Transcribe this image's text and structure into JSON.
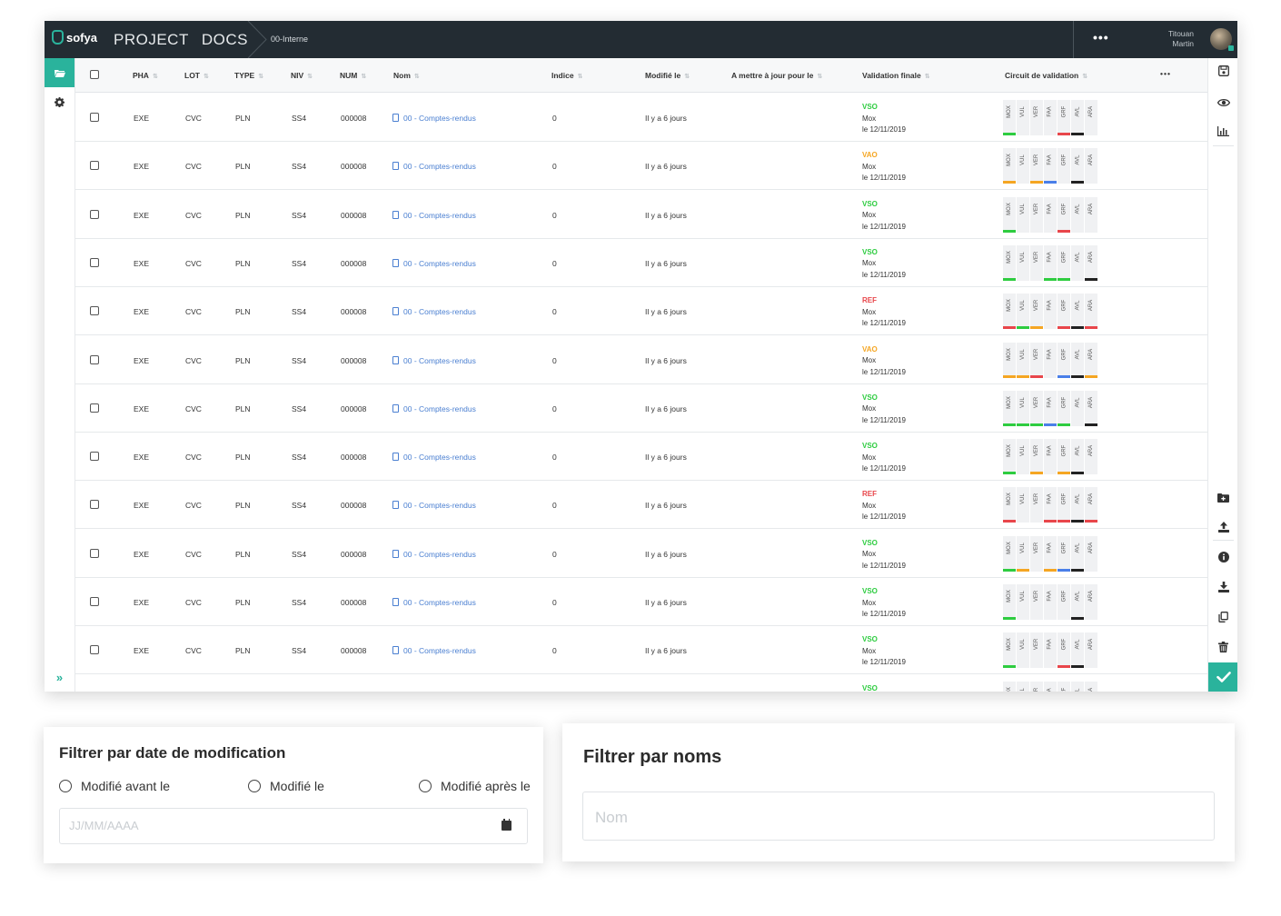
{
  "app": {
    "logo_text": "sofya",
    "title_word1": "PROJECT",
    "title_word2": "DOCS",
    "breadcrumb": "00-Interne",
    "more_label": "•••",
    "user_first": "Titouan",
    "user_last": "Martin"
  },
  "colors": {
    "accent": "#2ab39c",
    "topbar": "#232c33",
    "green": "#2ecc40",
    "orange": "#f5a623",
    "red": "#e8464b",
    "blue": "#4a7fe8",
    "black": "#222222",
    "link": "#4a7fd1"
  },
  "table": {
    "columns": [
      "PHA",
      "LOT",
      "TYPE",
      "NIV",
      "NUM",
      "Nom",
      "Indice",
      "Modifié le",
      "A mettre à jour pour le",
      "Validation finale",
      "Circuit de validation"
    ],
    "more_label": "•••",
    "circuit_labels": [
      "MOX",
      "VUL",
      "VER",
      "FAA",
      "GRF",
      "AVL",
      "ARA"
    ],
    "rows": [
      {
        "pha": "EXE",
        "lot": "CVC",
        "type": "PLN",
        "niv": "SS4",
        "num": "000008",
        "nom": "00 - Comptes-rendus",
        "indice": "0",
        "modifie": "Il y a 6 jours",
        "status": "VSO",
        "status_color": "#2ecc40",
        "by": "Mox",
        "date": "le 12/11/2019",
        "bars": [
          "#2ecc40",
          null,
          null,
          null,
          "#e8464b",
          "#222222",
          null
        ]
      },
      {
        "pha": "EXE",
        "lot": "CVC",
        "type": "PLN",
        "niv": "SS4",
        "num": "000008",
        "nom": "00 - Comptes-rendus",
        "indice": "0",
        "modifie": "Il y a 6 jours",
        "status": "VAO",
        "status_color": "#f5a623",
        "by": "Mox",
        "date": "le 12/11/2019",
        "bars": [
          "#f5a623",
          null,
          "#f5a623",
          "#4a7fe8",
          null,
          "#222222",
          null
        ]
      },
      {
        "pha": "EXE",
        "lot": "CVC",
        "type": "PLN",
        "niv": "SS4",
        "num": "000008",
        "nom": "00 - Comptes-rendus",
        "indice": "0",
        "modifie": "Il y a 6 jours",
        "status": "VSO",
        "status_color": "#2ecc40",
        "by": "Mox",
        "date": "le 12/11/2019",
        "bars": [
          "#2ecc40",
          null,
          null,
          null,
          "#e8464b",
          null,
          null
        ]
      },
      {
        "pha": "EXE",
        "lot": "CVC",
        "type": "PLN",
        "niv": "SS4",
        "num": "000008",
        "nom": "00 - Comptes-rendus",
        "indice": "0",
        "modifie": "Il y a 6 jours",
        "status": "VSO",
        "status_color": "#2ecc40",
        "by": "Mox",
        "date": "le 12/11/2019",
        "bars": [
          "#2ecc40",
          null,
          null,
          "#2ecc40",
          "#2ecc40",
          null,
          "#222222"
        ]
      },
      {
        "pha": "EXE",
        "lot": "CVC",
        "type": "PLN",
        "niv": "SS4",
        "num": "000008",
        "nom": "00 - Comptes-rendus",
        "indice": "0",
        "modifie": "Il y a 6 jours",
        "status": "REF",
        "status_color": "#e8464b",
        "by": "Mox",
        "date": "le 12/11/2019",
        "bars": [
          "#e8464b",
          "#2ecc40",
          "#f5a623",
          null,
          "#e8464b",
          "#222222",
          "#e8464b"
        ]
      },
      {
        "pha": "EXE",
        "lot": "CVC",
        "type": "PLN",
        "niv": "SS4",
        "num": "000008",
        "nom": "00 - Comptes-rendus",
        "indice": "0",
        "modifie": "Il y a 6 jours",
        "status": "VAO",
        "status_color": "#f5a623",
        "by": "Mox",
        "date": "le 12/11/2019",
        "bars": [
          "#f5a623",
          "#f5a623",
          "#e8464b",
          null,
          "#4a7fe8",
          "#222222",
          "#f5a623"
        ]
      },
      {
        "pha": "EXE",
        "lot": "CVC",
        "type": "PLN",
        "niv": "SS4",
        "num": "000008",
        "nom": "00 - Comptes-rendus",
        "indice": "0",
        "modifie": "Il y a 6 jours",
        "status": "VSO",
        "status_color": "#2ecc40",
        "by": "Mox",
        "date": "le 12/11/2019",
        "bars": [
          "#2ecc40",
          "#2ecc40",
          "#2ecc40",
          "#4a7fe8",
          "#2ecc40",
          null,
          "#222222"
        ]
      },
      {
        "pha": "EXE",
        "lot": "CVC",
        "type": "PLN",
        "niv": "SS4",
        "num": "000008",
        "nom": "00 - Comptes-rendus",
        "indice": "0",
        "modifie": "Il y a 6 jours",
        "status": "VSO",
        "status_color": "#2ecc40",
        "by": "Mox",
        "date": "le 12/11/2019",
        "bars": [
          "#2ecc40",
          null,
          "#f5a623",
          null,
          "#f5a623",
          "#222222",
          null
        ]
      },
      {
        "pha": "EXE",
        "lot": "CVC",
        "type": "PLN",
        "niv": "SS4",
        "num": "000008",
        "nom": "00 - Comptes-rendus",
        "indice": "0",
        "modifie": "Il y a 6 jours",
        "status": "REF",
        "status_color": "#e8464b",
        "by": "Mox",
        "date": "le 12/11/2019",
        "bars": [
          "#e8464b",
          null,
          null,
          "#e8464b",
          "#e8464b",
          "#222222",
          "#e8464b"
        ]
      },
      {
        "pha": "EXE",
        "lot": "CVC",
        "type": "PLN",
        "niv": "SS4",
        "num": "000008",
        "nom": "00 - Comptes-rendus",
        "indice": "0",
        "modifie": "Il y a 6 jours",
        "status": "VSO",
        "status_color": "#2ecc40",
        "by": "Mox",
        "date": "le 12/11/2019",
        "bars": [
          "#2ecc40",
          "#f5a623",
          null,
          "#f5a623",
          "#4a7fe8",
          "#222222",
          null
        ]
      },
      {
        "pha": "EXE",
        "lot": "CVC",
        "type": "PLN",
        "niv": "SS4",
        "num": "000008",
        "nom": "00 - Comptes-rendus",
        "indice": "0",
        "modifie": "Il y a 6 jours",
        "status": "VSO",
        "status_color": "#2ecc40",
        "by": "Mox",
        "date": "le 12/11/2019",
        "bars": [
          "#2ecc40",
          null,
          null,
          null,
          null,
          "#222222",
          null
        ]
      },
      {
        "pha": "EXE",
        "lot": "CVC",
        "type": "PLN",
        "niv": "SS4",
        "num": "000008",
        "nom": "00 - Comptes-rendus",
        "indice": "0",
        "modifie": "Il y a 6 jours",
        "status": "VSO",
        "status_color": "#2ecc40",
        "by": "Mox",
        "date": "le 12/11/2019",
        "bars": [
          "#2ecc40",
          null,
          null,
          null,
          "#e8464b",
          "#222222",
          null
        ]
      },
      {
        "pha": "",
        "lot": "",
        "type": "",
        "niv": "",
        "num": "",
        "nom": "",
        "indice": "",
        "modifie": "",
        "status": "VSO",
        "status_color": "#2ecc40",
        "by": "",
        "date": "",
        "bars": [
          null,
          null,
          null,
          null,
          null,
          null,
          null
        ]
      }
    ]
  },
  "icons": {
    "left": [
      "folder-icon",
      "gear-icon",
      "double-chevron-right-icon"
    ],
    "right_top": [
      "save-icon",
      "eye-icon",
      "chart-icon"
    ],
    "right_bottom": [
      "add-folder-icon",
      "upload-icon",
      "info-icon",
      "download-icon",
      "copy-icon",
      "trash-icon",
      "check-icon"
    ]
  },
  "filter_date": {
    "title": "Filtrer par date de modification",
    "options": [
      "Modifié avant le",
      "Modifié le",
      "Modifié après le"
    ],
    "placeholder": "JJ/MM/AAAA"
  },
  "filter_name": {
    "title": "Filtrer par noms",
    "placeholder": "Nom"
  }
}
